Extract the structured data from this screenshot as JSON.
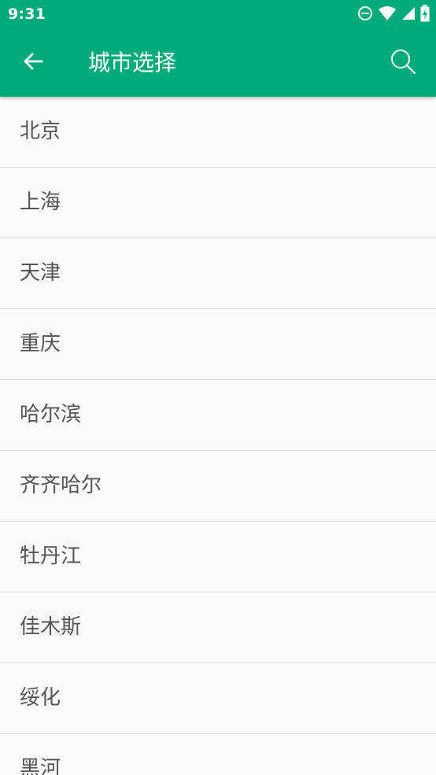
{
  "status_bar": {
    "time": "9:31",
    "icons": [
      "do-not-disturb-icon",
      "wifi-icon",
      "signal-icon",
      "battery-charging-icon"
    ]
  },
  "app_bar": {
    "title": "城市选择",
    "back_icon": "arrow-back-icon",
    "search_icon": "search-icon"
  },
  "colors": {
    "primary": "#00ab7a",
    "background": "#fafafa",
    "text": "#555555",
    "divider": "#dcdcdc"
  },
  "cities": [
    "北京",
    "上海",
    "天津",
    "重庆",
    "哈尔滨",
    "齐齐哈尔",
    "牡丹江",
    "佳木斯",
    "绥化",
    "黑河"
  ]
}
